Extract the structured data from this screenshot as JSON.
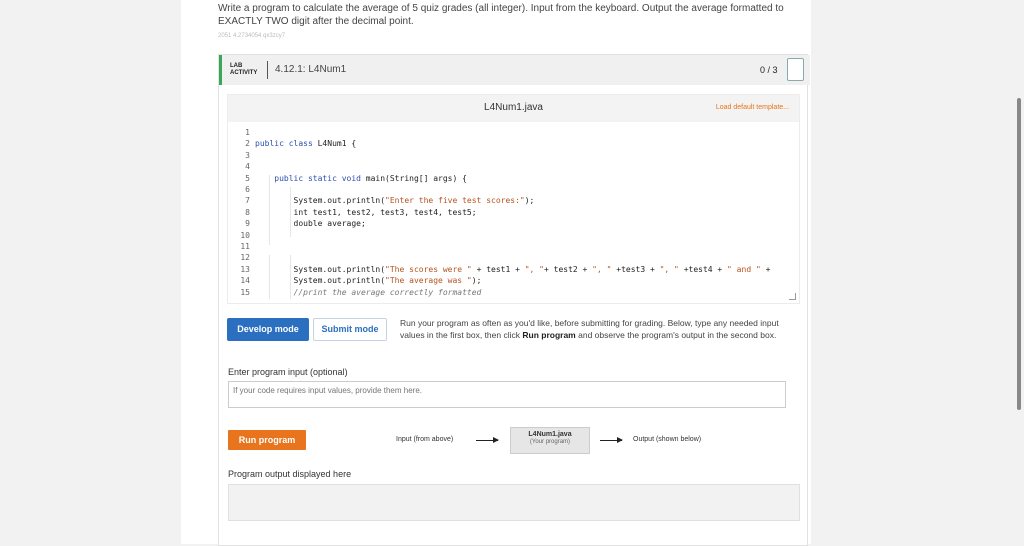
{
  "question": {
    "prompt": "Write a program to calculate the average of 5 quiz grades (all integer). Input from the keyboard. Output the average formatted to EXACTLY TWO digit after the decimal point.",
    "ident": "2051 4.2734054 qx3zcy7"
  },
  "lab": {
    "badge_line1": "LAB",
    "badge_line2": "ACTIVITY",
    "title": "4.12.1: L4Num1",
    "score": "0 / 3",
    "accent_color": "#3aa857"
  },
  "editor": {
    "file_name": "L4Num1.java",
    "load_default": "Load default template...",
    "line_numbers": [
      "1",
      "2",
      "3",
      "4",
      "5",
      "6",
      "7",
      "8",
      "9",
      "10",
      "11",
      "12",
      "13",
      "14",
      "15"
    ],
    "code": {
      "line2_kw": "public class",
      "line2_rest": " L4Num1 {",
      "line5_kw": "public static void",
      "line5_rest": " main(String[] args) {",
      "line7_pre": "System.out.println(",
      "line7_str": "\"Enter the five test scores:\"",
      "line7_post": ");",
      "line8": "int test1, test2, test3, test4, test5;",
      "line9": "double average;",
      "line13_pre": "System.out.println(",
      "line13_str1": "\"The scores were \"",
      "line13_mid1": " + test1 + ",
      "line13_str2": "\", \"",
      "line13_mid2": "+ test2 + ",
      "line13_str3": "\", \"",
      "line13_mid3": " +test3 + ",
      "line13_str4": "\", \"",
      "line13_mid4": " +test4 + ",
      "line13_str5": "\" and \"",
      "line13_tail": " +",
      "line14_pre": "System.out.println(",
      "line14_str": "\"The average was \"",
      "line14_post": ");",
      "line15": "//print the average correctly formatted"
    }
  },
  "modes": {
    "develop_label": "Develop mode",
    "submit_label": "Submit mode",
    "description_pre": "Run your program as often as you'd like, before submitting for grading. Below, type any needed input values in the first box, then click ",
    "description_bold": "Run program",
    "description_post": " and observe the program's output in the second box."
  },
  "input": {
    "label": "Enter program input (optional)",
    "placeholder": "If your code requires input values, provide them here."
  },
  "run": {
    "button_label": "Run program",
    "flow_input": "Input (from above)",
    "program_name": "L4Num1.java",
    "program_sub": "(Your program)",
    "flow_output": "Output (shown below)",
    "button_color": "#e8741d"
  },
  "output": {
    "label": "Program output displayed here"
  }
}
